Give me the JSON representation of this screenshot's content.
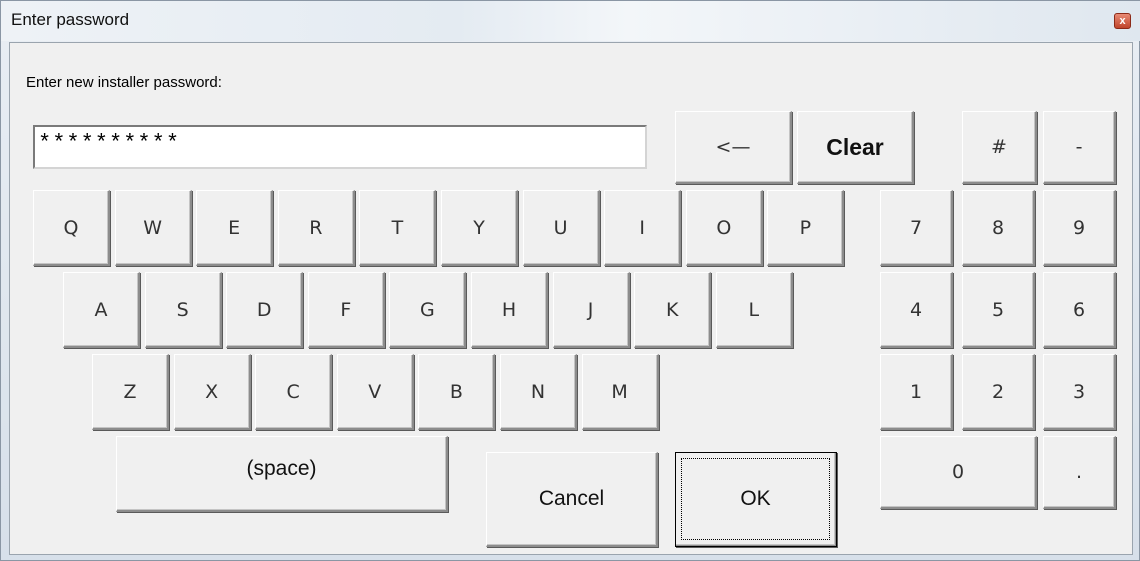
{
  "window": {
    "title": "Enter password",
    "close_glyph": "x"
  },
  "prompt": "Enter new installer password:",
  "password_field": {
    "value": "**********"
  },
  "keys": {
    "backspace": "<—",
    "clear": "Clear",
    "hash": "#",
    "minus": "-",
    "row1": [
      "Q",
      "W",
      "E",
      "R",
      "T",
      "Y",
      "U",
      "I",
      "O",
      "P"
    ],
    "row2": [
      "A",
      "S",
      "D",
      "F",
      "G",
      "H",
      "J",
      "K",
      "L"
    ],
    "row3": [
      "Z",
      "X",
      "C",
      "V",
      "B",
      "N",
      "M"
    ],
    "space": "(space)",
    "numpad": [
      "7",
      "8",
      "9",
      "4",
      "5",
      "6",
      "1",
      "2",
      "3"
    ],
    "zero": "0",
    "dot": "."
  },
  "buttons": {
    "cancel": "Cancel",
    "ok": "OK"
  }
}
